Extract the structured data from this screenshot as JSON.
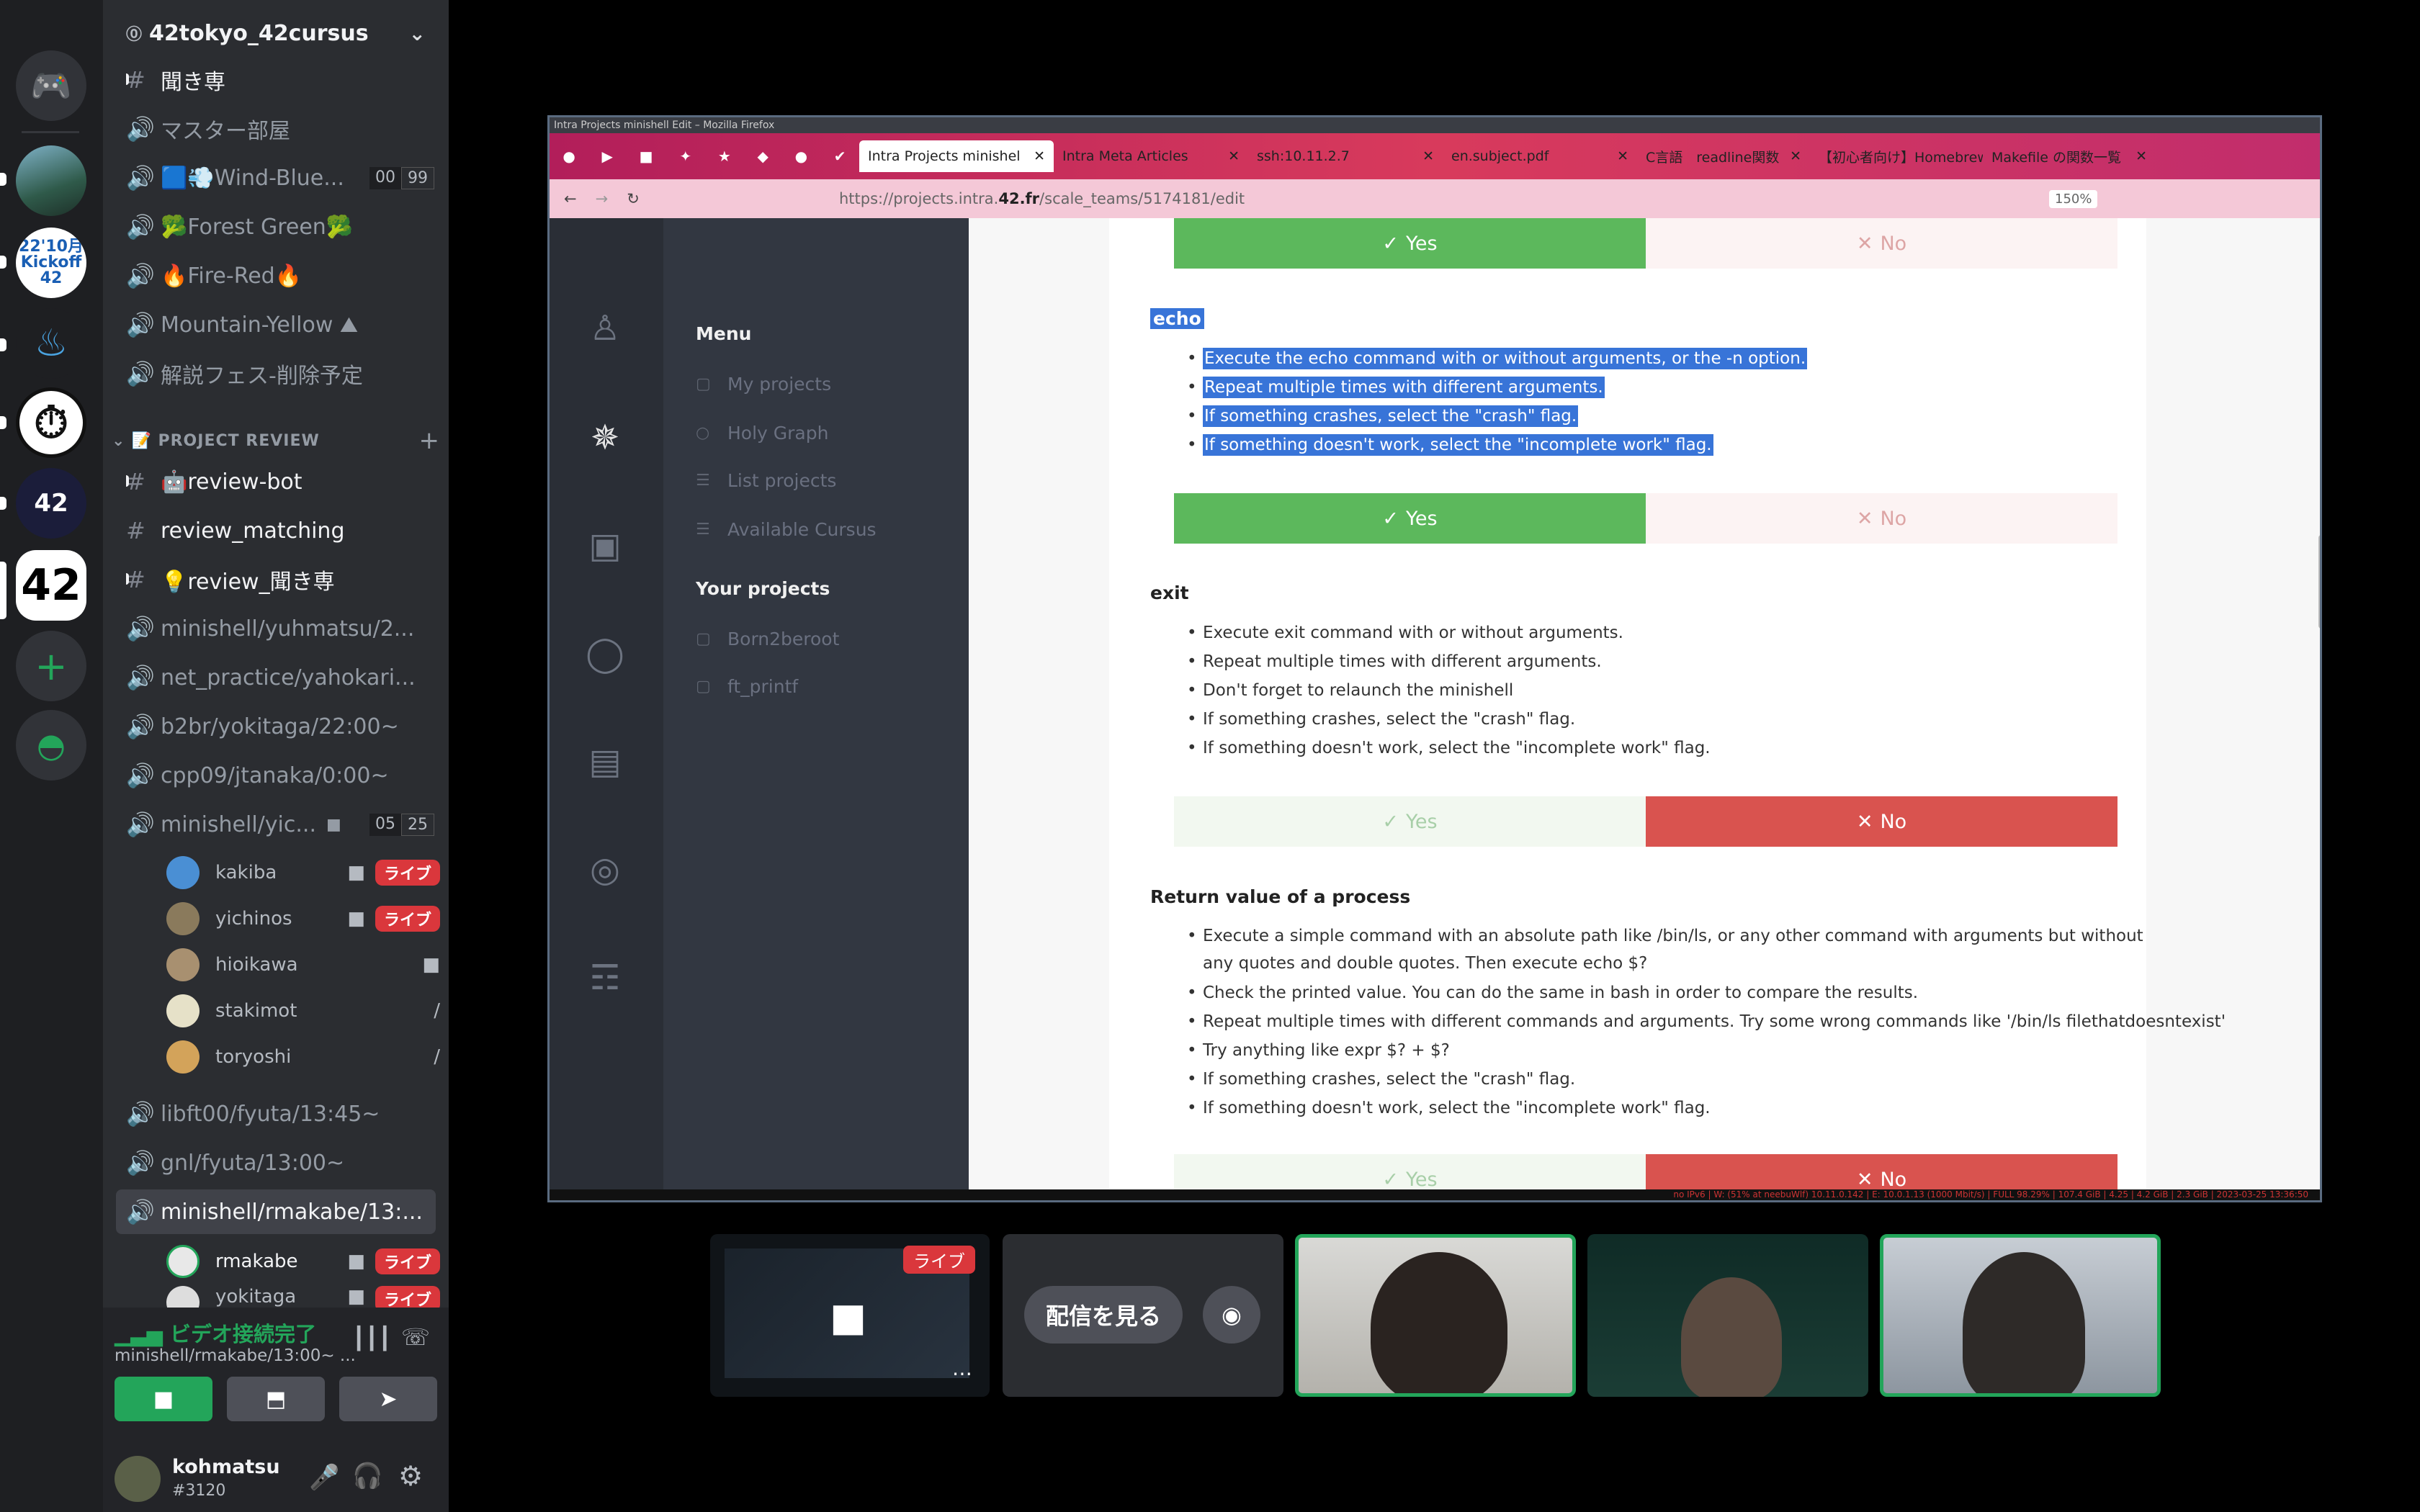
{
  "guild": {
    "name": "42tokyo_42cursus",
    "badge": "⓪"
  },
  "channels": {
    "items": [
      {
        "label": "聞き専",
        "icon": "hash-icon"
      },
      {
        "label": "マスター部屋",
        "icon": "speaker-icon"
      },
      {
        "label": "🟦💨Wind-Blue...",
        "icon": "speaker-icon",
        "count_a": "00",
        "count_b": "99"
      },
      {
        "label": "🥦Forest Green🥦",
        "icon": "speaker-icon"
      },
      {
        "label": "🔥Fire-Red🔥",
        "icon": "speaker-icon"
      },
      {
        "label": "Mountain-Yellow ⛰",
        "icon": "speaker-icon"
      },
      {
        "label": "解説フェス-削除予定",
        "icon": "speaker-icon"
      }
    ],
    "category": "📝 PROJECT REVIEW",
    "review_items": [
      {
        "label": "🤖review-bot",
        "icon": "hash-icon"
      },
      {
        "label": "review_matching",
        "icon": "hash-icon"
      },
      {
        "label": "💡review_聞き専",
        "icon": "hash-icon"
      },
      {
        "label": "minishell/yuhmatsu/2...",
        "icon": "speaker-icon"
      },
      {
        "label": "net_practice/yahokari...",
        "icon": "speaker-icon"
      },
      {
        "label": "b2br/yokitaga/22:00~",
        "icon": "speaker-icon"
      },
      {
        "label": "cpp09/jtanaka/0:00~",
        "icon": "speaker-icon"
      },
      {
        "label": "minishell/yic...",
        "icon": "speaker-icon",
        "count_a": "05",
        "count_b": "25"
      }
    ],
    "voice_users": [
      {
        "name": "kakiba",
        "live": "ライブ"
      },
      {
        "name": "yichinos",
        "live": "ライブ"
      },
      {
        "name": "hioikawa",
        "live": ""
      },
      {
        "name": "stakimot",
        "live": ""
      },
      {
        "name": "toryoshi",
        "live": ""
      }
    ],
    "more_items": [
      {
        "label": "libft00/fyuta/13:45~"
      },
      {
        "label": "gnl/fyuta/13:00~"
      },
      {
        "label": "minishell/rmakabe/13:..."
      }
    ],
    "sel_users": [
      {
        "name": "rmakabe",
        "live": "ライブ"
      },
      {
        "name": "yokitaga",
        "live": "ライブ"
      }
    ]
  },
  "voice": {
    "status": "ビデオ接続完了",
    "channel": "minishell/rmakabe/13:00~ ..."
  },
  "user": {
    "name": "kohmatsu",
    "tag": "#3120"
  },
  "browser": {
    "title": "Intra Projects minishell Edit – Mozilla Firefox",
    "tabs": [
      "Intra Projects minishel",
      "Intra Meta Articles",
      "ssh:10.11.2.7",
      "en.subject.pdf",
      "C言語　readline関数",
      "【初心者向け】Homebrew",
      "Makefile の関数一覧"
    ],
    "url_host": "https://projects.intra.",
    "url_bold": "42.fr",
    "url_path": "/scale_teams/5174181/edit",
    "zoom": "150%"
  },
  "intra": {
    "menu_title": "Menu",
    "menu_items": [
      "My projects",
      "Holy Graph",
      "List projects",
      "Available Cursus"
    ],
    "projects_title": "Your projects",
    "projects": [
      "Born2beroot",
      "ft_printf"
    ]
  },
  "eval": {
    "yes": "Yes",
    "no": "No",
    "echo_title": "echo",
    "echo_items": [
      "Execute the echo command with or without arguments, or the -n option.",
      "Repeat multiple times with different arguments.",
      "If something crashes, select the \"crash\" flag.",
      "If something doesn't work, select the \"incomplete work\" flag."
    ],
    "exit_title": "exit",
    "exit_items": [
      "Execute exit command with or without arguments.",
      "Repeat multiple times with different arguments.",
      "Don't forget to relaunch the minishell",
      "If something crashes, select the \"crash\" flag.",
      "If something doesn't work, select the \"incomplete work\" flag."
    ],
    "ret_title": "Return value of a process",
    "ret_items": [
      "Execute a simple command with an absolute path like /bin/ls, or any other command with arguments but without any quotes and double quotes. Then execute echo $?",
      "Check the printed value. You can do the same in bash in order to compare the results.",
      "Repeat multiple times with different commands and arguments. Try some wrong commands like '/bin/ls filethatdoesntexist'",
      "Try anything like expr $? + $?",
      "If something crashes, select the \"crash\" flag.",
      "If something doesn't work, select the \"incomplete work\" flag."
    ]
  },
  "stage": {
    "live_badge": "ライブ",
    "watch": "配信を見る"
  },
  "status_bar": "no IPv6 | W: (51% at neebuWlf) 10.11.0.142 | E: 10.0.1.13 (1000 Mbit/s) | FULL 98.29% | 107.4 GiB | 4.25 | 4.2 GiB | 2.3 GiB | 2023-03-25 13:36:50"
}
